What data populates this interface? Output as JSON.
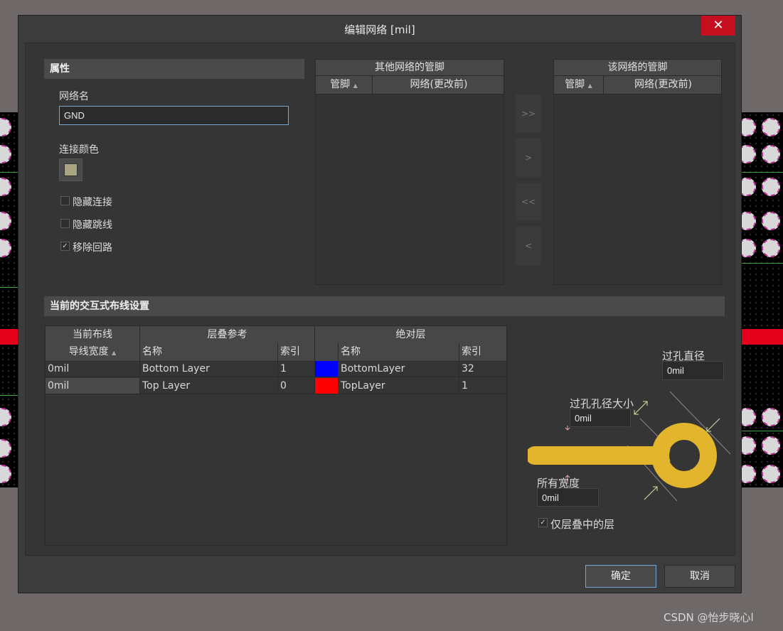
{
  "window": {
    "title": "编辑网络 [mil]",
    "close_glyph": "✕"
  },
  "properties": {
    "section": "属性",
    "net_name_label": "网络名",
    "net_name_value": "GND",
    "conn_color_label": "连接颜色",
    "conn_color": "#a8a680",
    "hide_connections": "隐藏连接",
    "hide_jumpers": "隐藏跳线",
    "remove_loops": "移除回路",
    "remove_loops_checked": "✓"
  },
  "other_pins": {
    "title": "其他网络的管脚",
    "col_pin": "管脚",
    "col_net": "网络(更改前)"
  },
  "this_pins": {
    "title": "该网络的管脚",
    "col_pin": "管脚",
    "col_net": "网络(更改前)"
  },
  "transfer": {
    "all_right": ">>",
    "right": ">",
    "all_left": "<<",
    "left": "<"
  },
  "routing": {
    "section": "当前的交互式布线设置",
    "group_current": "当前布线",
    "group_stack": "层叠参考",
    "group_abs": "绝对层",
    "col_width": "导线宽度",
    "col_name": "名称",
    "col_index": "索引",
    "col_abs_name": "名称",
    "col_abs_index": "索引",
    "rows": [
      {
        "width": "0mil",
        "name": "Bottom Layer",
        "index": "1",
        "color": "#0000ff",
        "abs_name": "BottomLayer",
        "abs_index": "32"
      },
      {
        "width": "0mil",
        "name": "Top Layer",
        "index": "0",
        "color": "#ff0000",
        "abs_name": "TopLayer",
        "abs_index": "1"
      }
    ]
  },
  "via": {
    "diameter_label": "过孔直径",
    "diameter_value": "0mil",
    "hole_label": "过孔孔径大小",
    "hole_value": "0mil",
    "width_label": "所有宽度",
    "width_value": "0mil",
    "stack_only_label": "仅层叠中的层",
    "stack_only_checked": "✓"
  },
  "footer": {
    "ok": "确定",
    "cancel": "取消"
  },
  "watermark": "CSDN @怡步晓心l",
  "colors": {
    "accent": "#6fa6d6",
    "close": "#c50f1f",
    "trace": "#e2b52c"
  }
}
